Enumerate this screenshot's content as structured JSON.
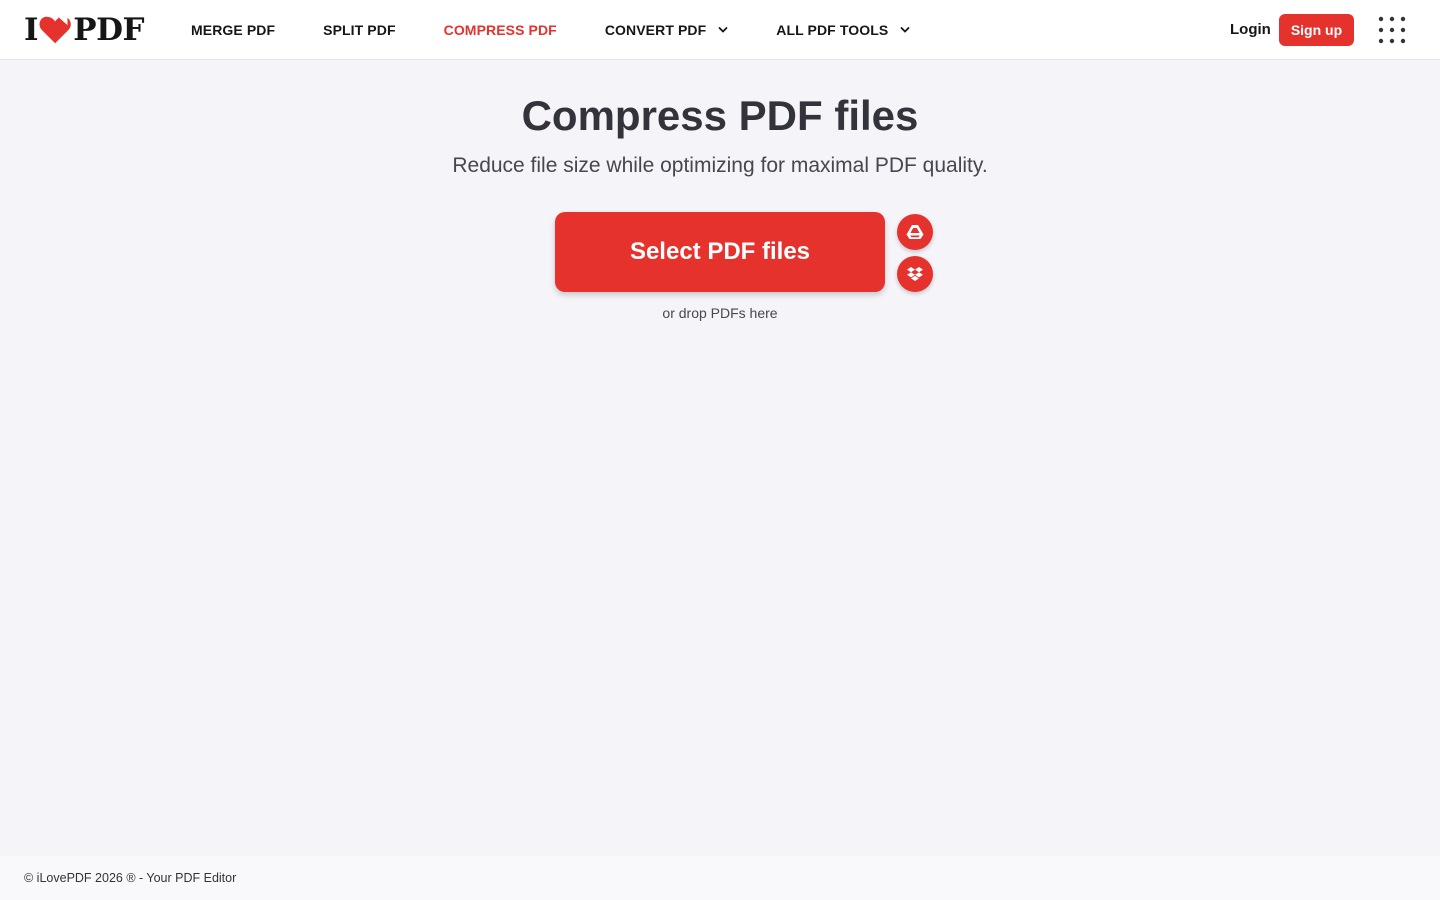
{
  "brand": {
    "logo_left": "I",
    "logo_right": "PDF",
    "accent": "#e5322d"
  },
  "nav": {
    "items": [
      {
        "label": "MERGE PDF",
        "dropdown": false,
        "active": false
      },
      {
        "label": "SPLIT PDF",
        "dropdown": false,
        "active": false
      },
      {
        "label": "COMPRESS PDF",
        "dropdown": false,
        "active": true
      },
      {
        "label": "CONVERT PDF",
        "dropdown": true,
        "active": false
      },
      {
        "label": "ALL PDF TOOLS",
        "dropdown": true,
        "active": false
      }
    ]
  },
  "account": {
    "login_label": "Login",
    "signup_label": "Sign up"
  },
  "main": {
    "title": "Compress PDF files",
    "subtitle": "Reduce file size while optimizing for maximal PDF quality.",
    "select_label": "Select PDF files",
    "drop_hint": "or drop PDFs here",
    "cloud_sources": [
      "google-drive-icon",
      "dropbox-icon"
    ]
  },
  "footer": {
    "text": "© iLovePDF 2026 ® - Your PDF Editor"
  }
}
